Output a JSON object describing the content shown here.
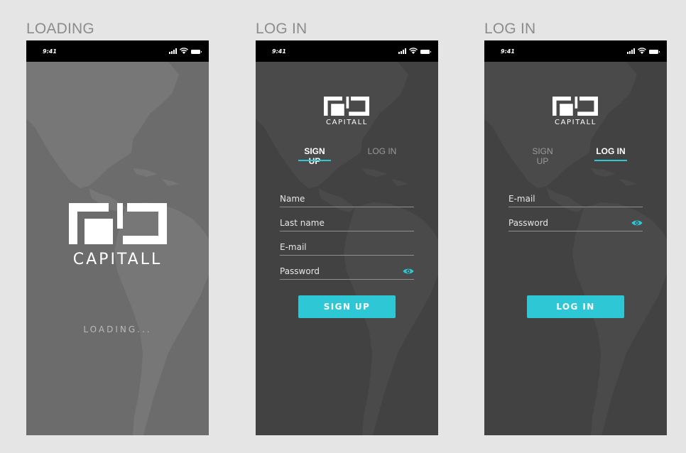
{
  "screens": [
    {
      "title": "LOADING",
      "time": "9:41",
      "brand": "CAPITALL",
      "loading_text": "LOADING..."
    },
    {
      "title": "LOG IN",
      "time": "9:41",
      "brand": "CAPITALL",
      "tabs": {
        "signup": "SIGN UP",
        "login": "LOG IN",
        "active": "signup"
      },
      "fields": [
        "Name",
        "Last name",
        "E-mail",
        "Password"
      ],
      "button": "SIGN UP"
    },
    {
      "title": "LOG IN",
      "time": "9:41",
      "brand": "CAPITALL",
      "tabs": {
        "signup": "SIGN UP",
        "login": "LOG IN",
        "active": "login"
      },
      "fields": [
        "E-mail",
        "Password"
      ],
      "button": "LOG IN"
    }
  ],
  "colors": {
    "accent": "#2ec7d6",
    "canvas": "#e5e5e5",
    "loading_bg": "#6c6c6c",
    "dark_bg": "#424242",
    "status_bar": "#000000"
  },
  "icons": [
    "signal-icon",
    "wifi-icon",
    "battery-icon",
    "eye-icon",
    "world-map",
    "capitall-logo"
  ]
}
